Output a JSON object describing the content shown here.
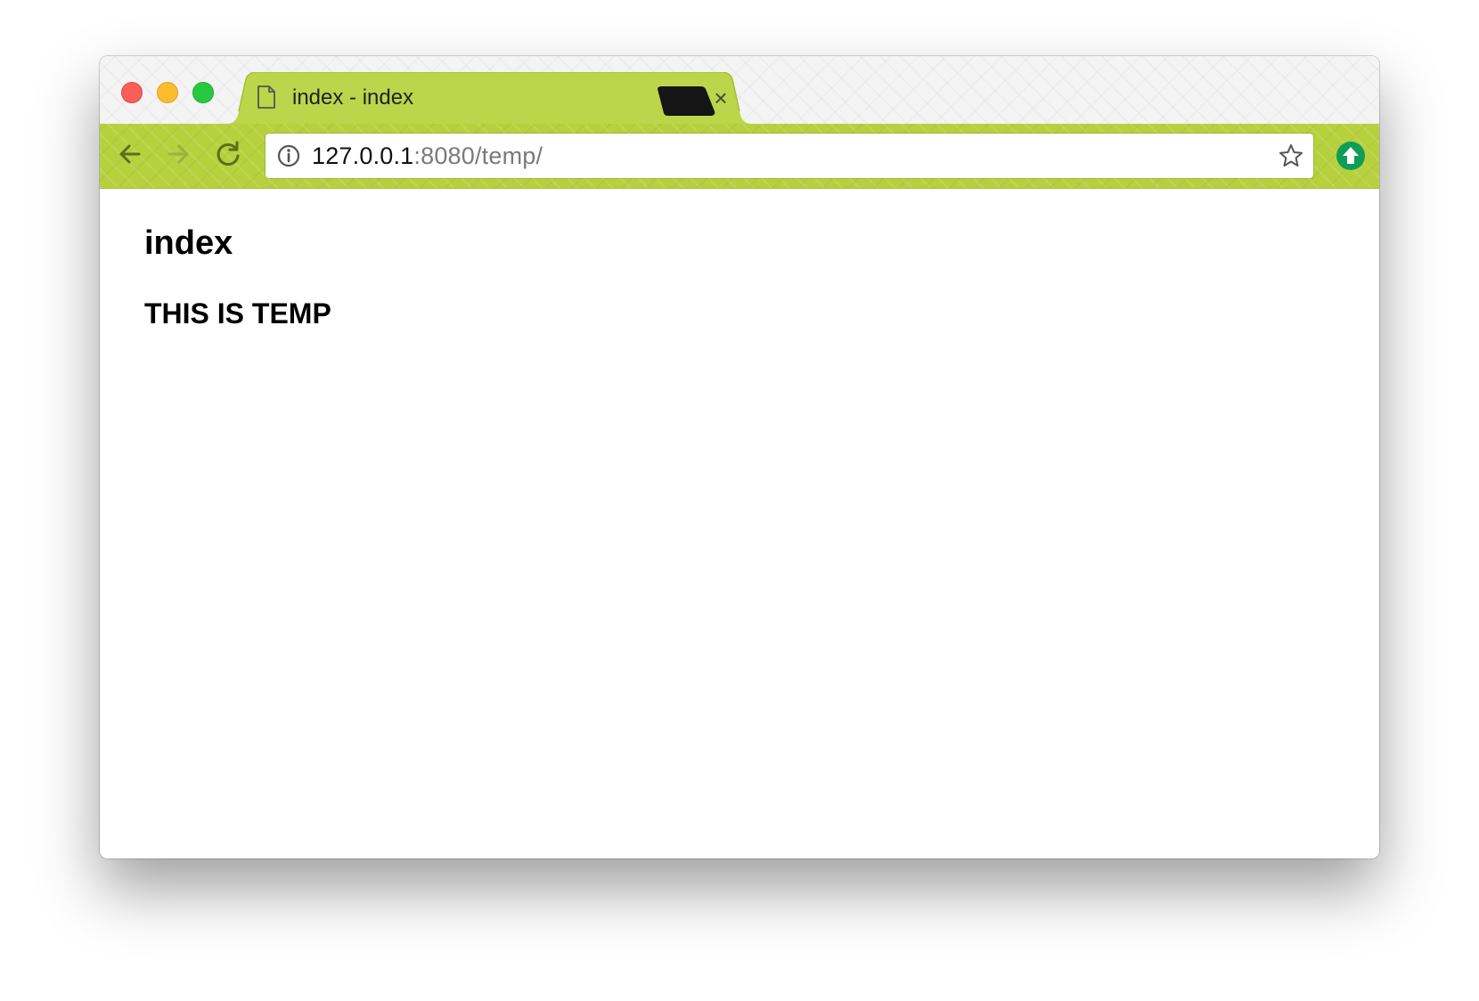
{
  "browser": {
    "tab": {
      "title": "index - index",
      "icon": "document-icon",
      "close_glyph": "×"
    },
    "address_bar": {
      "url_host": "127.0.0.1",
      "url_rest": ":8080/temp/",
      "info_icon": "info-icon",
      "bookmark_icon": "star-icon"
    },
    "extension_icon": "upload-arrow-icon",
    "theme_color": "#b7d13e"
  },
  "page": {
    "heading": "index",
    "subheading": "THIS IS TEMP"
  }
}
